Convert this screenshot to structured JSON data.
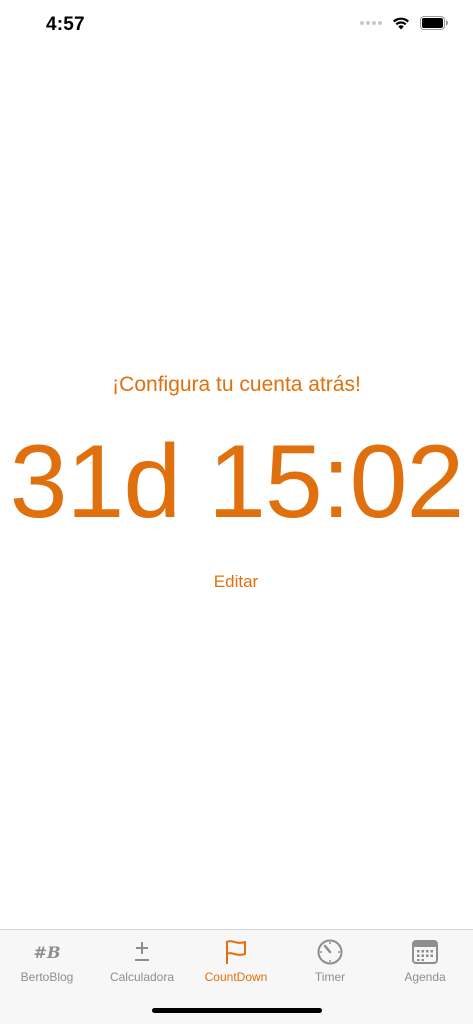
{
  "status_bar": {
    "time": "4:57"
  },
  "main": {
    "subtitle": "¡Configura tu cuenta atrás!",
    "countdown": "31d 15:02",
    "edit_label": "Editar"
  },
  "tab_bar": {
    "active_color": "#e0700d",
    "inactive_color": "#8e8e8e",
    "tabs": [
      {
        "label": "BertoBlog",
        "icon": "hash-b-icon",
        "glyph": "#B"
      },
      {
        "label": "Calculadora",
        "icon": "plus-minus-icon",
        "glyph": "±"
      },
      {
        "label": "CountDown",
        "icon": "flag-icon",
        "active": true
      },
      {
        "label": "Timer",
        "icon": "timer-icon"
      },
      {
        "label": "Agenda",
        "icon": "calendar-icon"
      }
    ]
  }
}
